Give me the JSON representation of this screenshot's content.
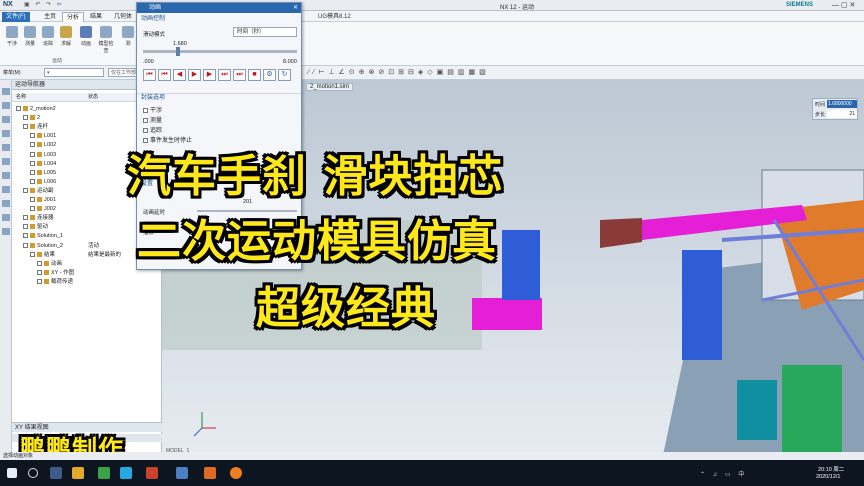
{
  "window": {
    "app_logo": "NX",
    "title": "NX 12 - 运动",
    "brand": "SIEMENS"
  },
  "tabs": [
    "文件(F)",
    "主页",
    "分析",
    "结果",
    "几何体"
  ],
  "ribbon": {
    "buttons": [
      "干涉",
      "测量",
      "追踪",
      "求解",
      "动画",
      "模型检查",
      "测"
    ],
    "group_label": "运动"
  },
  "cmdbar": {
    "menu_label": "菜单(M)",
    "filter_placeholder": "仅在工作部件"
  },
  "navigator": {
    "title": "运动导航器",
    "columns": [
      "名称",
      "状态"
    ],
    "tree": [
      {
        "label": "2_motion2",
        "level": 0,
        "status": ""
      },
      {
        "label": "2",
        "level": 1,
        "status": ""
      },
      {
        "label": "连杆",
        "level": 1,
        "status": ""
      },
      {
        "label": "L001",
        "level": 2,
        "status": ""
      },
      {
        "label": "L002",
        "level": 2,
        "status": ""
      },
      {
        "label": "L003",
        "level": 2,
        "status": ""
      },
      {
        "label": "L004",
        "level": 2,
        "status": ""
      },
      {
        "label": "L005",
        "level": 2,
        "status": ""
      },
      {
        "label": "L006",
        "level": 2,
        "status": ""
      },
      {
        "label": "运动副",
        "level": 1,
        "status": ""
      },
      {
        "label": "J001",
        "level": 2,
        "status": ""
      },
      {
        "label": "J002",
        "level": 2,
        "status": ""
      },
      {
        "label": "连接器",
        "level": 1,
        "status": ""
      },
      {
        "label": "驱动",
        "level": 1,
        "status": ""
      },
      {
        "label": "Solution_1",
        "level": 1,
        "status": ""
      },
      {
        "label": "Solution_2",
        "level": 1,
        "status": "活动"
      },
      {
        "label": "结果",
        "level": 2,
        "status": "结果是最新的"
      },
      {
        "label": "动画",
        "level": 3,
        "status": ""
      },
      {
        "label": "XY - 作图",
        "level": 3,
        "status": ""
      },
      {
        "label": "载荷传递",
        "level": 3,
        "status": ""
      }
    ],
    "xy_panel": "XY 结果视图",
    "status_text": "选择动画对象"
  },
  "dialog": {
    "title": "动画",
    "section1": "动画控制",
    "mode_label": "滑动模式",
    "mode_value": "时间（秒）",
    "slider_value": "1.680",
    "range_min": ".000",
    "range_max": "8.000",
    "play_glyphs": [
      "⏮",
      "⏮",
      "◀",
      "▶",
      "▶",
      "⏭",
      "⏭",
      "■"
    ],
    "section2": "封装选项",
    "options": [
      "干涉",
      "测量",
      "追踪",
      "事件发生时停止"
    ],
    "section3": "设置",
    "frame_label": "动画延时",
    "frame_value": "201",
    "playback_label": "播放"
  },
  "viewport": {
    "file_tab": "2_motion1.sim",
    "time_label": "时间",
    "time_value": "1.6800000",
    "step_label": "步长",
    "step_value": "21",
    "corner_label": "MODEL_1"
  },
  "overlay": {
    "line1": "汽车手刹 滑块抽芯",
    "line2": "二次运动模具仿真",
    "line3": "超级经典",
    "watermark": "鹏鹏制作"
  },
  "taskbar": {
    "time": "20:10 周二",
    "date": "2020/12/1"
  },
  "colors": {
    "overlay_text": "#ffe81a",
    "magenta_part": "#e41fd6",
    "blue_part": "#2f5dd8",
    "orange_part": "#e07b2b",
    "green_part": "#28a85a"
  }
}
